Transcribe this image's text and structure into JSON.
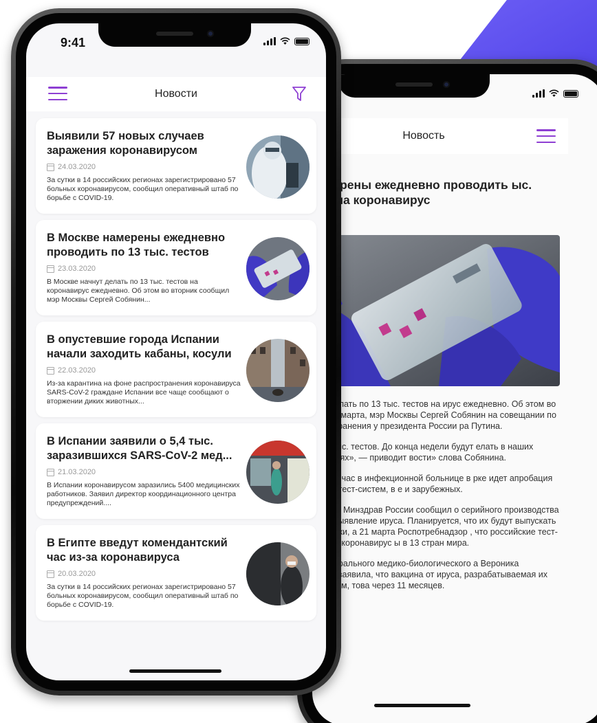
{
  "colors": {
    "accent": "#8e3fd3",
    "background_shape": "#5a4cf0"
  },
  "list_screen": {
    "status": {
      "time": "9:41"
    },
    "header": {
      "title": "Новости",
      "menu_icon": "hamburger-icon",
      "filter_icon": "filter-icon"
    },
    "news": [
      {
        "title": "Выявили 57 новых случаев заражения коронавирусом",
        "date": "24.03.2020",
        "summary": "За сутки в 14 российских регионах зарегистрировано 57 больных коронавирусом, сообщил оперативный штаб по борьбе с COVID-19."
      },
      {
        "title": "В Москве намерены ежедневно проводить по 13 тыс. тестов",
        "date": "23.03.2020",
        "summary": "В Москве начнут делать по 13 тыс. тестов на коронавирус ежедневно. Об этом во вторник сообщил мэр Москвы Сергей Собянин..."
      },
      {
        "title": "В опустевшие города Испании начали заходить кабаны, косули",
        "date": "22.03.2020",
        "summary": "Из-за карантина на фоне распространения коронавируса SARS-CoV-2 граждане Испании все чаще сообщают о вторжении диких животных..."
      },
      {
        "title": "В Испании заявили о 5,4 тыс. заразившихся SARS-CoV-2 мед...",
        "date": "21.03.2020",
        "summary": "В Испании коронавирусом заразились 5400 медицинских работников. Заявил директор координационного центра предупреждений...."
      },
      {
        "title": "В Египте введут комендантский час из-за коронавируса",
        "date": "20.03.2020",
        "summary": "За сутки в 14 российских регионах зарегистрировано 57 больных коронавирусом, сообщил оперативный штаб по борьбе с COVID-19."
      }
    ]
  },
  "article_screen": {
    "header": {
      "title": "Новость",
      "menu_icon": "hamburger-icon"
    },
    "title": "ве намерены ежедневно проводить ыс. тестов на коронавирус",
    "date": "20",
    "paragraphs": [
      "е начнут делать по 13 тыс. тестов на ирус ежедневно. Об этом во вторник, 24 марта, мэр Москвы Сергей Собянин на совещании по м здравоохранения у президента России ра Путина.",
      "делали 3 тыс. тестов. До конца недели будут елать в наших лабораториях», — приводит вости» слова Собянина.",
      "вил, что сейчас в инфекционной больнице в рке идет апробация различных тест-систем, в е и зарубежных.",
      "е, 23 марта, Минздрав России сообщил о серийного производства тестов на выявление ируса. Планируется, что их будут выпускать по тук в сутки, а 21 марта Роспотребнадзор , что российские тест-системы на коронавирус ы в 13 стран мира.",
      "глава Федерального медико-биологического а Вероника Скворцова заявила, что вакцина от ируса, разрабатываемая их учреждением, това через 11 месяцев."
    ]
  }
}
